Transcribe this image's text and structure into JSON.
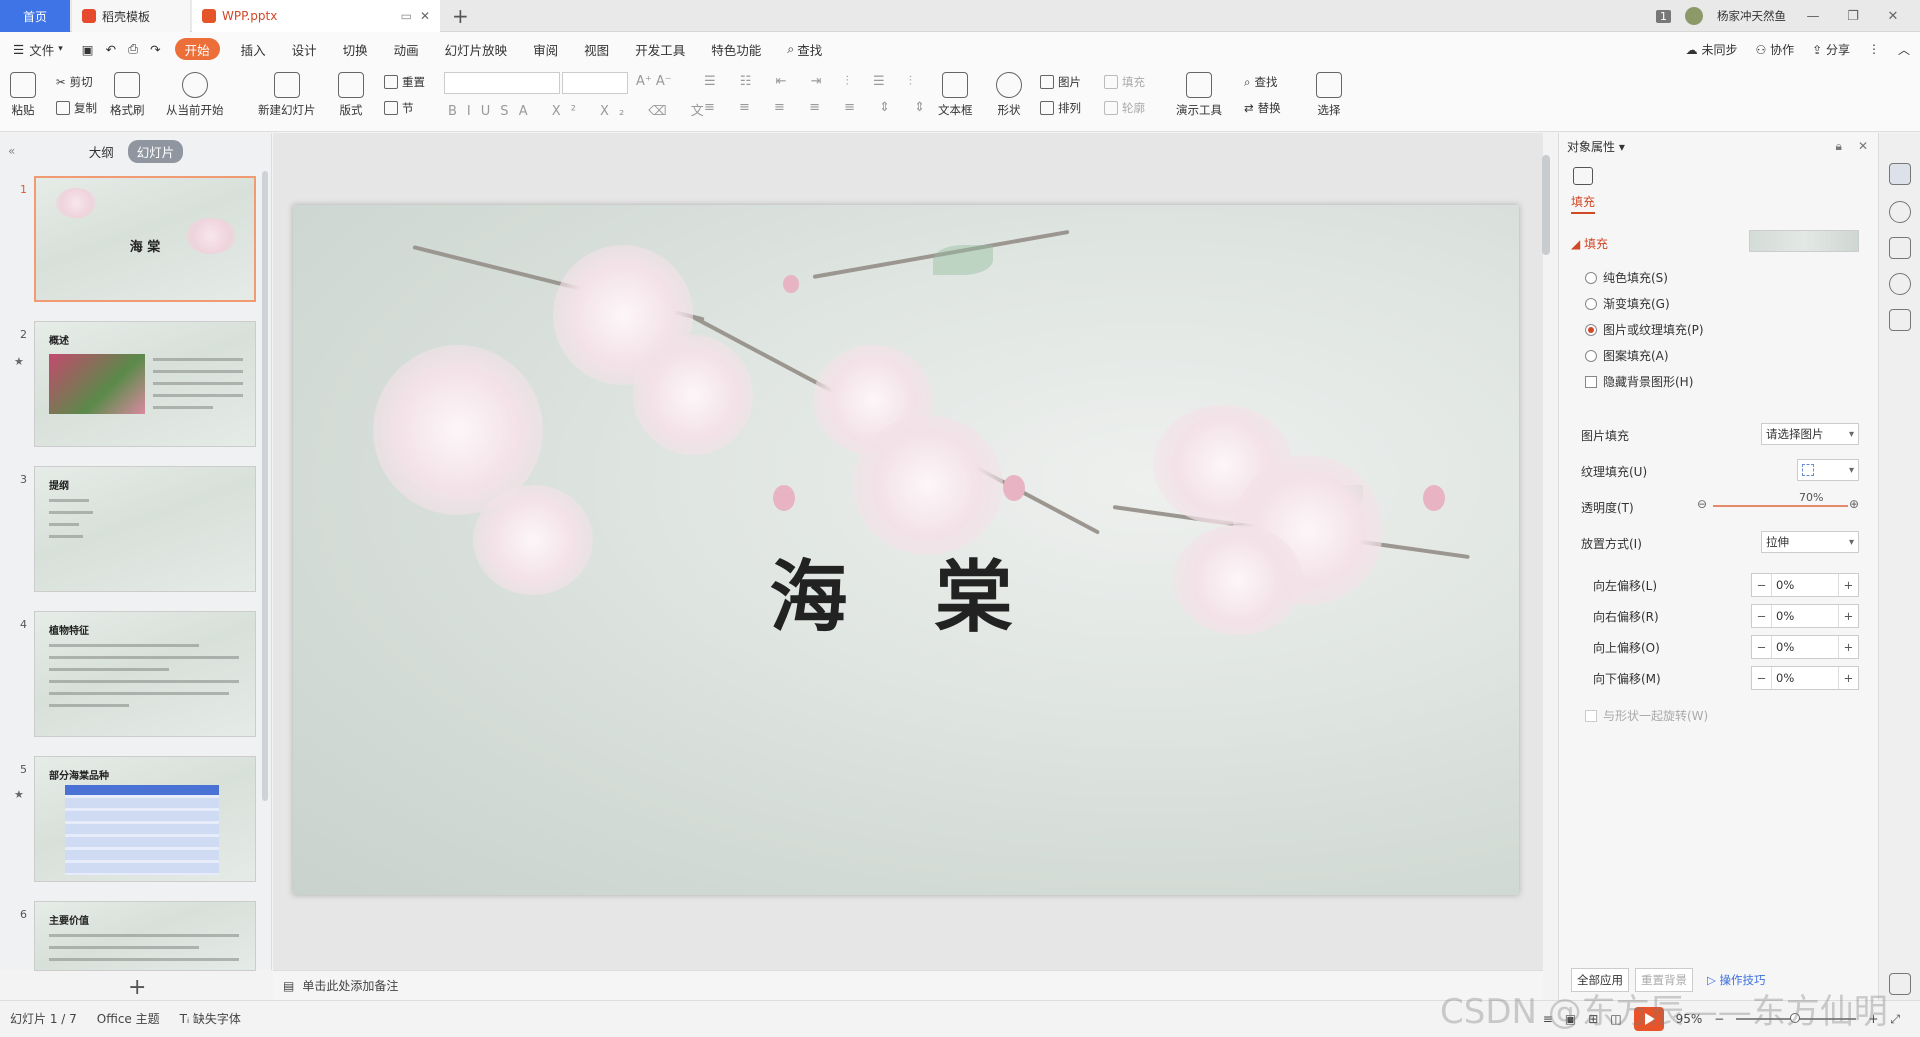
{
  "tabs": {
    "home": "首页",
    "template": "稻壳模板",
    "doc": "WPP.pptx"
  },
  "titlebar": {
    "badge": "1",
    "user": "杨家冲天然鱼"
  },
  "menu": [
    "文件",
    "开始",
    "插入",
    "设计",
    "切换",
    "动画",
    "幻灯片放映",
    "审阅",
    "视图",
    "开发工具",
    "特色功能",
    "查找"
  ],
  "menu_right": {
    "sync": "未同步",
    "collab": "协作",
    "share": "分享"
  },
  "ribbon": {
    "paste": "粘贴",
    "cut": "剪切",
    "copy": "复制",
    "format_painter": "格式刷",
    "from_current": "从当前开始",
    "new_slide": "新建幻灯片",
    "layout": "版式",
    "reset": "重置",
    "section": "节",
    "textbox": "文本框",
    "shape": "形状",
    "picture": "图片",
    "fill": "填充",
    "arrange": "排列",
    "outline": "轮廓",
    "present_tool": "演示工具",
    "find": "查找",
    "replace": "替换",
    "select": "选择"
  },
  "left_panel": {
    "tab_outline": "大纲",
    "tab_slides": "幻灯片"
  },
  "slides": [
    {
      "num": "1",
      "title": "海 棠"
    },
    {
      "num": "2",
      "title": "概述"
    },
    {
      "num": "3",
      "title": "提纲"
    },
    {
      "num": "4",
      "title": "植物特征"
    },
    {
      "num": "5",
      "title": "部分海棠品种"
    },
    {
      "num": "6",
      "title": "主要价值"
    }
  ],
  "slide_main": {
    "title": "海 棠"
  },
  "notes": {
    "placeholder": "单击此处添加备注"
  },
  "right_panel": {
    "title": "对象属性",
    "tab": "填充",
    "section": "填充",
    "options": [
      "纯色填充(S)",
      "渐变填充(G)",
      "图片或纹理填充(P)",
      "图案填充(A)"
    ],
    "selected_option": "图片或纹理填充(P)",
    "hide_bg": "隐藏背景图形(H)",
    "pic_fill_label": "图片填充",
    "pic_fill_value": "请选择图片",
    "texture_label": "纹理填充(U)",
    "transparency_label": "透明度(T)",
    "transparency_value": "70%",
    "placement_label": "放置方式(I)",
    "placement_value": "拉伸",
    "offsets": [
      {
        "label": "向左偏移(L)",
        "value": "0%"
      },
      {
        "label": "向右偏移(R)",
        "value": "0%"
      },
      {
        "label": "向上偏移(O)",
        "value": "0%"
      },
      {
        "label": "向下偏移(M)",
        "value": "0%"
      }
    ],
    "rotate_with_shape": "与形状一起旋转(W)",
    "apply_all": "全部应用",
    "reset_bg": "重置背景",
    "tips": "操作技巧"
  },
  "status": {
    "slide_count": "幻灯片 1 / 7",
    "theme": "Office 主题",
    "missing_font": "缺失字体",
    "zoom": "95%"
  },
  "watermark": "CSDN @东方辰——东方仙明",
  "colors": {
    "accent": "#d24726",
    "home_tab": "#3f74e6",
    "active_menu": "#ec6f3a"
  }
}
